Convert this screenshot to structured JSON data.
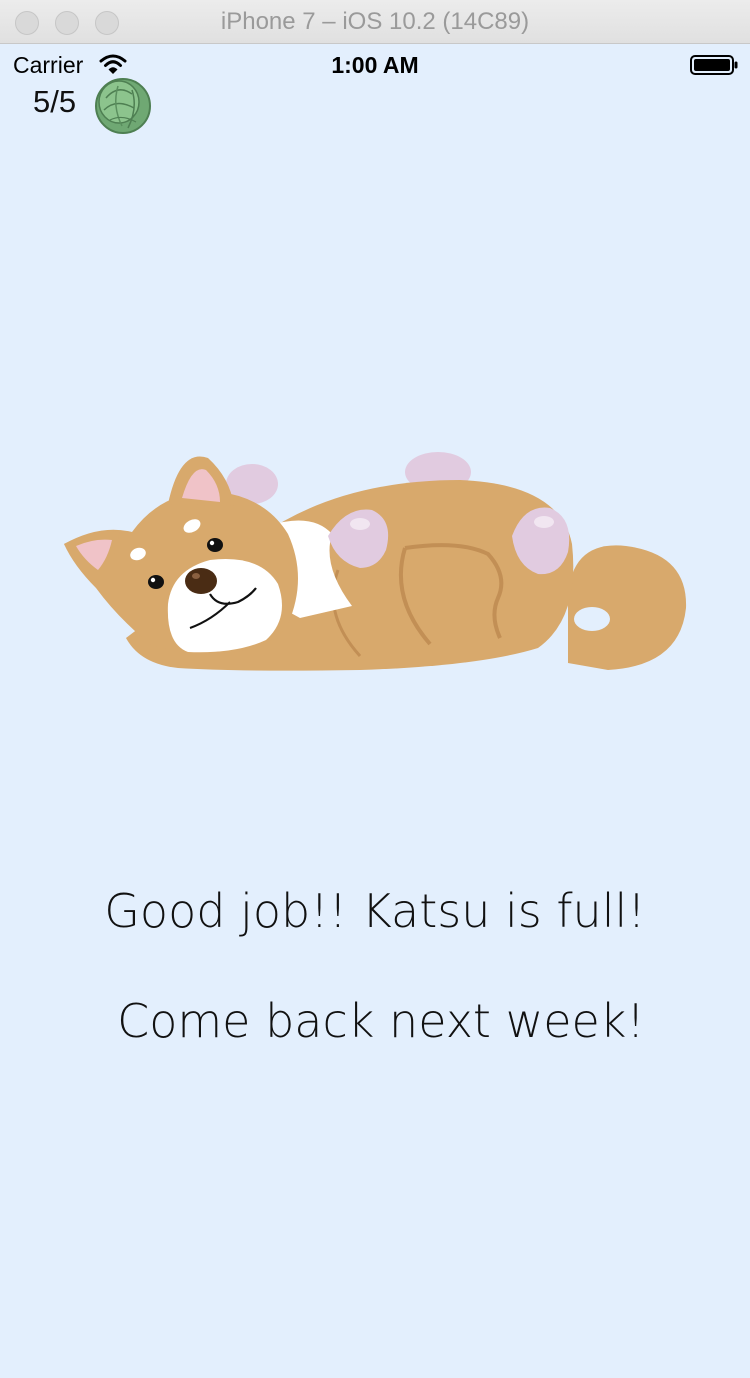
{
  "window": {
    "title": "iPhone 7 – iOS 10.2 (14C89)"
  },
  "status_bar": {
    "carrier": "Carrier",
    "time": "1:00 AM"
  },
  "counter": {
    "text": "5/5",
    "icon": "cabbage-icon"
  },
  "illustration": {
    "icon": "sleeping-shiba-dog"
  },
  "messages": {
    "line1": "Good job!! Katsu is full!",
    "line2": "Come back next week!"
  },
  "colors": {
    "background": "#e3effd",
    "dog_fur": "#d8a96c",
    "dog_white": "#ffffff",
    "paws": "#e1cbe0",
    "cabbage": "#7fb882"
  }
}
